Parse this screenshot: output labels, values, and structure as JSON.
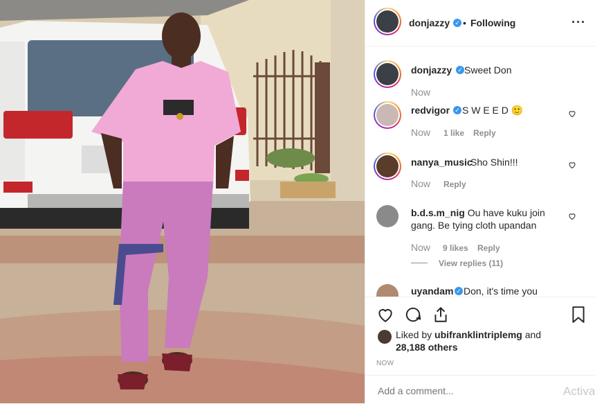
{
  "post": {
    "author": "donjazzy",
    "following_label": "Following",
    "separator": "•",
    "menu_icon": "more-horizontal-icon"
  },
  "caption": {
    "user": "donjazzy",
    "text": "Sweet Don",
    "time": "Now"
  },
  "comments": [
    {
      "user": "redvigor",
      "verified": true,
      "text": "S W E E D 🙂",
      "time": "Now",
      "likes": "1 like",
      "reply": "Reply"
    },
    {
      "user": "nanya_music",
      "verified": false,
      "text": "Sho Shin!!!",
      "time": "Now",
      "likes": "",
      "reply": "Reply"
    },
    {
      "user": "b.d.s.m_nig",
      "verified": false,
      "text": "Ou have kuku join gang. Be tying cloth upandan",
      "time": "Now",
      "likes": "9 likes",
      "reply": "Reply",
      "view_replies": "View replies (11)"
    },
    {
      "user": "uyandam",
      "verified": true,
      "text": "Don, it's time you"
    }
  ],
  "likes": {
    "prefix": "Liked by",
    "user": "ubifranklintriplemg",
    "and": "and",
    "others": "28,188 others"
  },
  "timestamp": "NOW",
  "add_comment": {
    "placeholder": "Add a comment..."
  },
  "watermark": "Activa",
  "colors": {
    "verified": "#3897f0",
    "muted": "#8e8e8e",
    "text": "#262626",
    "shirt": "#f1a9d6",
    "trousers": "#c97bbd"
  }
}
